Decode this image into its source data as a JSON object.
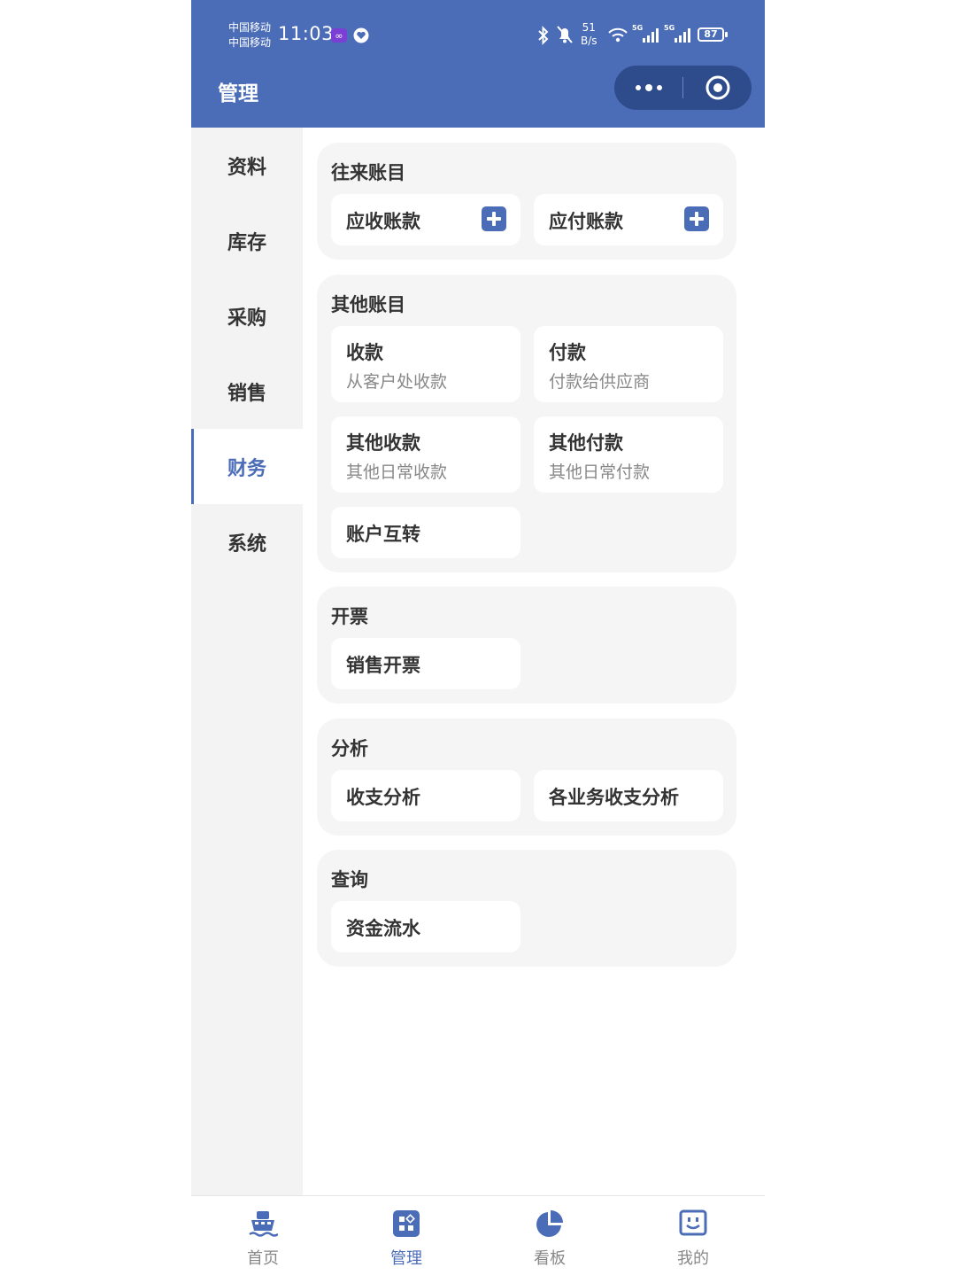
{
  "status_bar": {
    "carrier_1": "中国移动",
    "carrier_2": "中国移动",
    "time": "11:03",
    "speed_value": "51",
    "speed_unit": "B/s",
    "signal_1": "5G",
    "signal_2": "5G",
    "battery": "87"
  },
  "header": {
    "title": "管理"
  },
  "sidebar": {
    "items": [
      {
        "label": "资料"
      },
      {
        "label": "库存"
      },
      {
        "label": "采购"
      },
      {
        "label": "销售"
      },
      {
        "label": "财务"
      },
      {
        "label": "系统"
      }
    ],
    "active": "财务"
  },
  "sections": [
    {
      "title": "往来账目",
      "cards": [
        {
          "title": "应收账款",
          "icon": "plus-icon"
        },
        {
          "title": "应付账款",
          "icon": "plus-icon"
        }
      ]
    },
    {
      "title": "其他账目",
      "cards": [
        {
          "title": "收款",
          "subtitle": "从客户处收款"
        },
        {
          "title": "付款",
          "subtitle": "付款给供应商"
        },
        {
          "title": "其他收款",
          "subtitle": "其他日常收款"
        },
        {
          "title": "其他付款",
          "subtitle": "其他日常付款"
        },
        {
          "title": "账户互转"
        }
      ]
    },
    {
      "title": "开票",
      "cards": [
        {
          "title": "销售开票"
        }
      ]
    },
    {
      "title": "分析",
      "cards": [
        {
          "title": "收支分析"
        },
        {
          "title": "各业务收支分析"
        }
      ]
    },
    {
      "title": "查询",
      "cards": [
        {
          "title": "资金流水"
        }
      ]
    }
  ],
  "tabbar": {
    "items": [
      {
        "label": "首页",
        "icon": "ship-icon"
      },
      {
        "label": "管理",
        "icon": "grid-icon"
      },
      {
        "label": "看板",
        "icon": "pie-chart-icon"
      },
      {
        "label": "我的",
        "icon": "profile-icon"
      }
    ],
    "active": "管理"
  },
  "colors": {
    "accent": "#4b6cb7",
    "header_bg": "#4b6cb7",
    "capsule_bg": "#2e4b8c"
  }
}
